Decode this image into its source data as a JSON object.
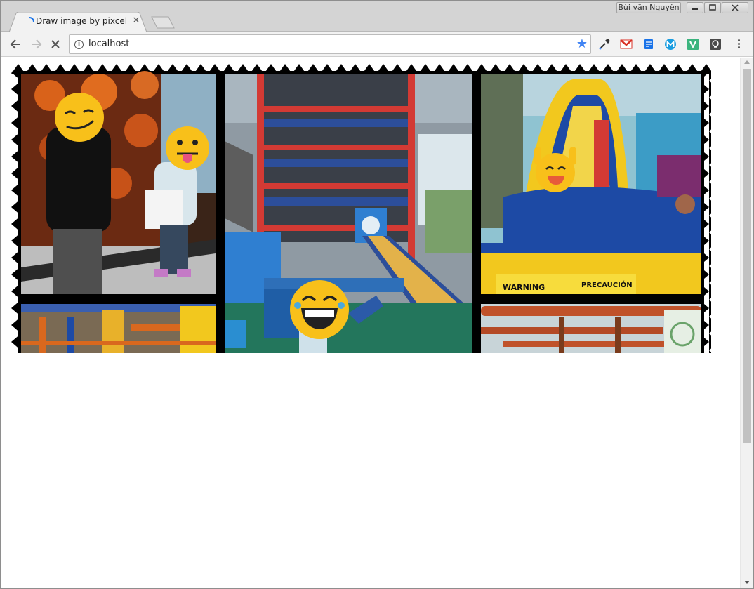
{
  "browser": {
    "tab": {
      "title": "Draw image by pixcel"
    },
    "user": "Bùi văn Nguyên",
    "address": {
      "url": "localhost"
    }
  },
  "colors": {
    "star": "#4285f4",
    "spinner": "#1a73e8",
    "gmail_red": "#d93025",
    "ext_blue": "#1a73e8",
    "ext_v_green": "#3bb47e"
  },
  "page": {
    "content": "collage of indoor playground photos with emoji stickers over faces, framed by a black zigzag border"
  }
}
